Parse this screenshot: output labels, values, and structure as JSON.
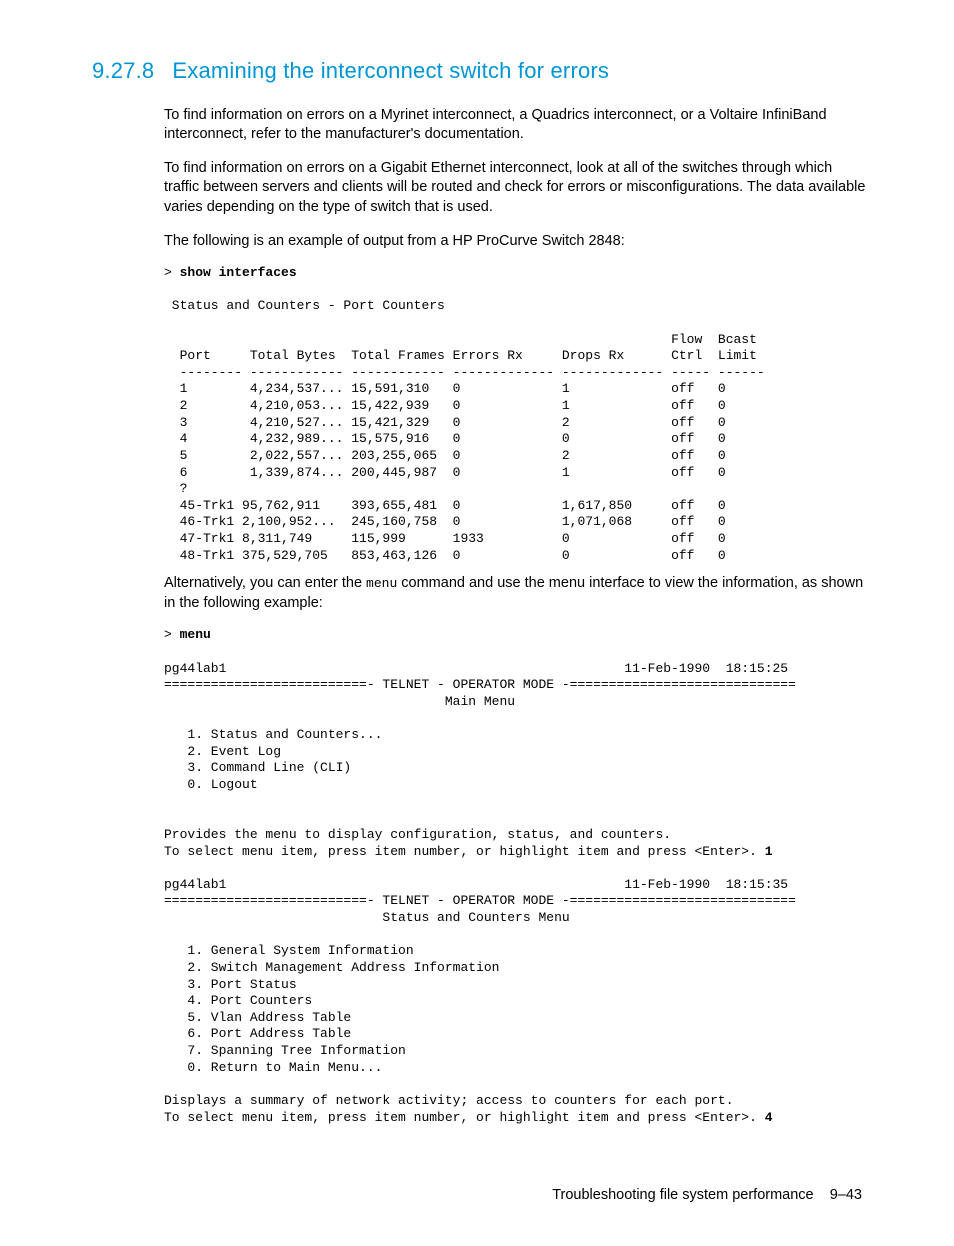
{
  "heading_number": "9.27.8",
  "heading_title": "Examining the interconnect switch for errors",
  "para1": "To find information on errors on a Myrinet interconnect, a Quadrics interconnect, or a Voltaire InfiniBand interconnect, refer to the manufacturer's documentation.",
  "para2": "To find information on errors on a Gigabit Ethernet interconnect, look at all of the switches through which traffic between servers and clients will be routed and check for errors or misconfigurations. The data available varies depending on the type of switch that is used.",
  "para3": "The following is an example of output from a HP ProCurve Switch 2848:",
  "cmd1_prompt": "> ",
  "cmd1": "show interfaces",
  "out1": " Status and Counters - Port Counters\n\n                                                                 Flow  Bcast\n  Port     Total Bytes  Total Frames Errors Rx     Drops Rx      Ctrl  Limit\n  -------- ------------ ------------ ------------- ------------- ----- ------\n  1        4,234,537... 15,591,310   0             1             off   0\n  2        4,210,053... 15,422,939   0             1             off   0\n  3        4,210,527... 15,421,329   0             2             off   0\n  4        4,232,989... 15,575,916   0             0             off   0\n  5        2,022,557... 203,255,065  0             2             off   0\n  6        1,339,874... 200,445,987  0             1             off   0\n  ?\n  45-Trk1 95,762,911    393,655,481  0             1,617,850     off   0\n  46-Trk1 2,100,952...  245,160,758  0             1,071,068     off   0\n  47-Trk1 8,311,749     115,999      1933          0             off   0\n  48-Trk1 375,529,705   853,463,126  0             0             off   0",
  "para4a": "Alternatively, you can enter the ",
  "para4_code": "menu",
  "para4b": " command and use the menu interface to view the information, as shown in the following example:",
  "cmd2_prompt": "> ",
  "cmd2": "menu",
  "out2a": "pg44lab1                                                   11-Feb-1990  18:15:25\n==========================- TELNET - OPERATOR MODE -=============================\n                                    Main Menu\n\n   1. Status and Counters...\n   2. Event Log\n   3. Command Line (CLI)\n   0. Logout\n\n\nProvides the menu to display configuration, status, and counters.\nTo select menu item, press item number, or highlight item and press <Enter>. ",
  "out2a_input": "1",
  "out2b": "pg44lab1                                                   11-Feb-1990  18:15:35\n==========================- TELNET - OPERATOR MODE -=============================\n                            Status and Counters Menu\n\n   1. General System Information\n   2. Switch Management Address Information\n   3. Port Status\n   4. Port Counters\n   5. Vlan Address Table\n   6. Port Address Table\n   7. Spanning Tree Information\n   0. Return to Main Menu...\n\nDisplays a summary of network activity; access to counters for each port.\nTo select menu item, press item number, or highlight item and press <Enter>. ",
  "out2b_input": "4",
  "footer_text": "Troubleshooting file system performance",
  "footer_page": "9–43"
}
